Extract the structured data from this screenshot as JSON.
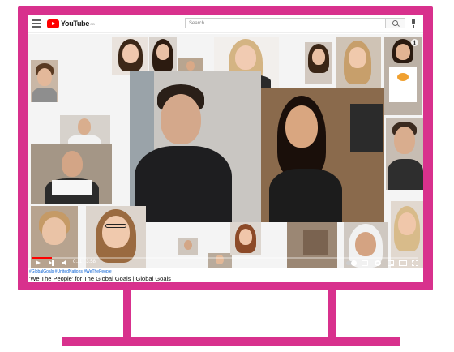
{
  "header": {
    "logo_text": "YouTube",
    "logo_superscript": "GB",
    "search_placeholder": "Search"
  },
  "player": {
    "time_display": "0:11 / 3:58",
    "progress": 0.05,
    "info_label": "i"
  },
  "video": {
    "hashtags": "#GlobalGoals #UnitedNations #WeThePeople",
    "title": "'We The People' for The Global Goals | Global Goals"
  },
  "colors": {
    "monitor_frame": "#d8318d",
    "youtube_red": "#ff0000",
    "hashtag_blue": "#065fd4"
  }
}
